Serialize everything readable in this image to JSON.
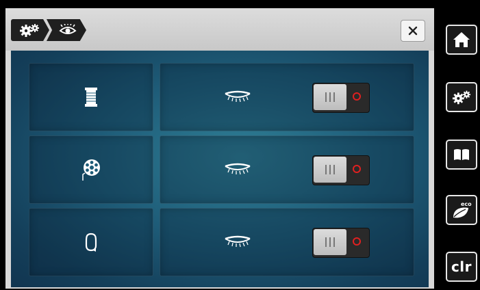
{
  "breadcrumb": {
    "items": [
      {
        "icon": "gears-icon"
      },
      {
        "icon": "eye-icon"
      }
    ]
  },
  "close_icon": "close-icon",
  "settings_rows": [
    {
      "row_icon": "thread-spool-icon",
      "state_icon": "closed-eye-icon",
      "toggle": "off"
    },
    {
      "row_icon": "bobbin-icon",
      "state_icon": "closed-eye-icon",
      "toggle": "off"
    },
    {
      "row_icon": "presser-foot-icon",
      "state_icon": "closed-eye-icon",
      "toggle": "off"
    }
  ],
  "sidebar": {
    "buttons": [
      {
        "icon": "home-icon"
      },
      {
        "icon": "settings-icon"
      },
      {
        "icon": "tutorial-book-icon"
      },
      {
        "icon": "eco-leaf-icon",
        "label": "eco"
      },
      {
        "icon": "clear-icon",
        "label": "clr"
      }
    ]
  },
  "colors": {
    "content_bg": "#1e5c78",
    "toggle_off_indicator": "#e02020"
  }
}
